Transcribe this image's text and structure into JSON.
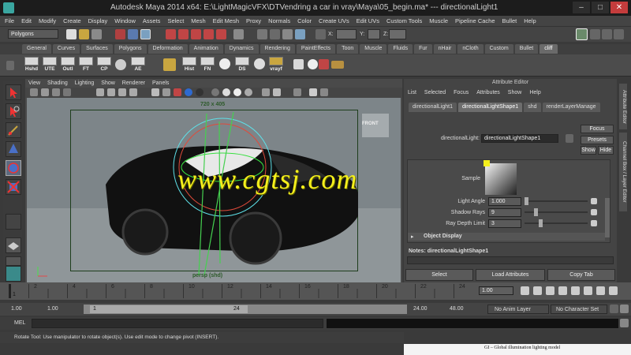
{
  "window": {
    "title": "Autodesk Maya 2014 x64: E:\\LightMagicVFX\\DTVendring a car in vray\\Maya\\05_begin.ma*   ---   directionalLight1"
  },
  "menubar": [
    "File",
    "Edit",
    "Modify",
    "Create",
    "Display",
    "Window",
    "Assets",
    "Select",
    "Mesh",
    "Edit Mesh",
    "Proxy",
    "Normals",
    "Color",
    "Create UVs",
    "Edit UVs",
    "Custom Tools",
    "Muscle",
    "Pipeline Cache",
    "Bullet",
    "Help"
  ],
  "status": {
    "mode": "Polygons",
    "x_label": "X:",
    "y_label": "Y:",
    "z_label": "Z:"
  },
  "shelf_tabs": [
    "General",
    "Curves",
    "Surfaces",
    "Polygons",
    "Deformation",
    "Animation",
    "Dynamics",
    "Rendering",
    "PaintEffects",
    "Toon",
    "Muscle",
    "Fluids",
    "Fur",
    "nHair",
    "nCloth",
    "Custom",
    "Bullet",
    "cliff"
  ],
  "shelf_active": "cliff",
  "shelf_buttons": [
    "Hshd",
    "UTE",
    "Outl",
    "FT",
    "CP",
    "AE",
    "Hist",
    "FN",
    "DS",
    "vrayf"
  ],
  "viewport": {
    "menu": [
      "View",
      "Shading",
      "Lighting",
      "Show",
      "Renderer",
      "Panels"
    ],
    "resolution": "720 x 405",
    "camera": "persp (shd)",
    "cube_label": "FRONT"
  },
  "attribute_editor": {
    "header": "Attribute Editor",
    "menu": [
      "List",
      "Selected",
      "Focus",
      "Attributes",
      "Show",
      "Help"
    ],
    "tabs": [
      "directionalLight1",
      "directionalLightShape1",
      "shd",
      "renderLayerManage"
    ],
    "active_tab": "directionalLightShape1",
    "node_label": "directionalLight:",
    "node_value": "directionalLightShape1",
    "focus_btn": "Focus",
    "presets_btn": "Presets",
    "show_btn": "Show",
    "hide_btn": "Hide",
    "sample_label": "Sample",
    "light_angle_label": "Light Angle",
    "light_angle_value": "1.000",
    "shadow_rays_label": "Shadow Rays",
    "shadow_rays_value": "9",
    "ray_depth_label": "Ray Depth Limit",
    "ray_depth_value": "3",
    "object_display": "Object Display",
    "notes": "Notes: directionalLightShape1",
    "select_btn": "Select",
    "load_btn": "Load Attributes",
    "copy_btn": "Copy Tab"
  },
  "side_tabs": [
    "Attribute Editor",
    "Channel Box / Layer Editor"
  ],
  "timeline": {
    "ticks": [
      "2",
      "4",
      "6",
      "8",
      "10",
      "12",
      "14",
      "16",
      "18",
      "20",
      "22",
      "24"
    ],
    "start_frame": "1",
    "current_frame": "1.00"
  },
  "range": {
    "start": "1.00",
    "anim_start": "1.00",
    "slider_start": "1",
    "slider_end": "24",
    "anim_end": "24.00",
    "end": "48.00",
    "anim_layer": "No Anim Layer",
    "char_set": "No Character Set"
  },
  "command_line": {
    "label": "MEL"
  },
  "help_line": "Rotate Tool: Use manipulator to rotate object(s). Use edit mode to change pivot (INSERT).",
  "watermark": "www.cgtsj.com",
  "bottom_caption": "GI – Global illumination lighting model"
}
